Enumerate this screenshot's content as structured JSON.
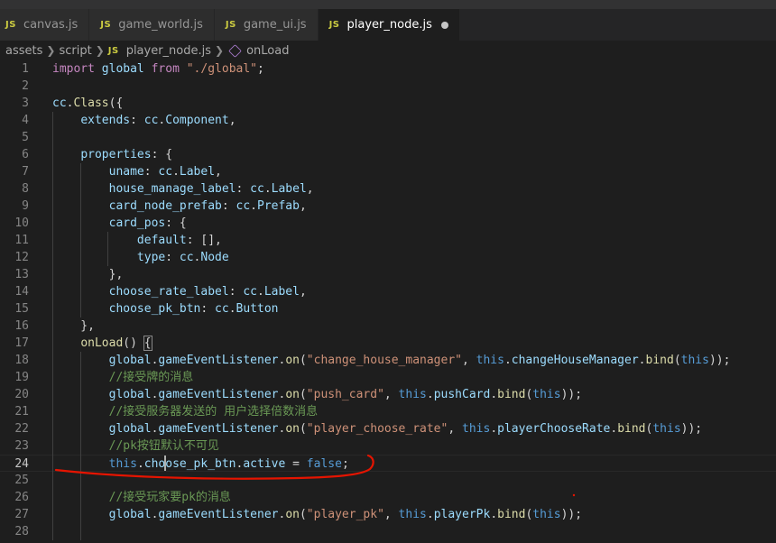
{
  "tabs": [
    {
      "label": "canvas.js",
      "active": false
    },
    {
      "label": "game_world.js",
      "active": false
    },
    {
      "label": "game_ui.js",
      "active": false
    },
    {
      "label": "player_node.js",
      "active": true,
      "dirty": true
    }
  ],
  "breadcrumb": {
    "items": [
      "assets",
      "script"
    ],
    "file": "player_node.js",
    "symbol": "onLoad"
  },
  "editor": {
    "current_line": 24,
    "lines": [
      {
        "n": "1",
        "tokens": [
          [
            "kw",
            "import"
          ],
          [
            "pun",
            " "
          ],
          [
            "var",
            "global"
          ],
          [
            "pun",
            " "
          ],
          [
            "kw",
            "from"
          ],
          [
            "pun",
            " "
          ],
          [
            "str",
            "\"./global\""
          ],
          [
            "pun",
            ";"
          ]
        ]
      },
      {
        "n": "2",
        "tokens": []
      },
      {
        "n": "3",
        "tokens": [
          [
            "var",
            "cc"
          ],
          [
            "pun",
            "."
          ],
          [
            "fn",
            "Class"
          ],
          [
            "pun",
            "({"
          ]
        ]
      },
      {
        "n": "4",
        "tokens": [
          [
            "pun",
            "    "
          ],
          [
            "var",
            "extends"
          ],
          [
            "pun",
            ": "
          ],
          [
            "var",
            "cc"
          ],
          [
            "pun",
            "."
          ],
          [
            "var",
            "Component"
          ],
          [
            "pun",
            ","
          ]
        ]
      },
      {
        "n": "5",
        "tokens": []
      },
      {
        "n": "6",
        "tokens": [
          [
            "pun",
            "    "
          ],
          [
            "var",
            "properties"
          ],
          [
            "pun",
            ": {"
          ]
        ]
      },
      {
        "n": "7",
        "tokens": [
          [
            "pun",
            "        "
          ],
          [
            "var",
            "uname"
          ],
          [
            "pun",
            ": "
          ],
          [
            "var",
            "cc"
          ],
          [
            "pun",
            "."
          ],
          [
            "var",
            "Label"
          ],
          [
            "pun",
            ","
          ]
        ]
      },
      {
        "n": "8",
        "tokens": [
          [
            "pun",
            "        "
          ],
          [
            "var",
            "house_manage_label"
          ],
          [
            "pun",
            ": "
          ],
          [
            "var",
            "cc"
          ],
          [
            "pun",
            "."
          ],
          [
            "var",
            "Label"
          ],
          [
            "pun",
            ","
          ]
        ]
      },
      {
        "n": "9",
        "tokens": [
          [
            "pun",
            "        "
          ],
          [
            "var",
            "card_node_prefab"
          ],
          [
            "pun",
            ": "
          ],
          [
            "var",
            "cc"
          ],
          [
            "pun",
            "."
          ],
          [
            "var",
            "Prefab"
          ],
          [
            "pun",
            ","
          ]
        ]
      },
      {
        "n": "10",
        "tokens": [
          [
            "pun",
            "        "
          ],
          [
            "var",
            "card_pos"
          ],
          [
            "pun",
            ": {"
          ]
        ]
      },
      {
        "n": "11",
        "tokens": [
          [
            "pun",
            "            "
          ],
          [
            "var",
            "default"
          ],
          [
            "pun",
            ": [],"
          ]
        ]
      },
      {
        "n": "12",
        "tokens": [
          [
            "pun",
            "            "
          ],
          [
            "var",
            "type"
          ],
          [
            "pun",
            ": "
          ],
          [
            "var",
            "cc"
          ],
          [
            "pun",
            "."
          ],
          [
            "var",
            "Node"
          ]
        ]
      },
      {
        "n": "13",
        "tokens": [
          [
            "pun",
            "        },"
          ]
        ]
      },
      {
        "n": "14",
        "tokens": [
          [
            "pun",
            "        "
          ],
          [
            "var",
            "choose_rate_label"
          ],
          [
            "pun",
            ": "
          ],
          [
            "var",
            "cc"
          ],
          [
            "pun",
            "."
          ],
          [
            "var",
            "Label"
          ],
          [
            "pun",
            ","
          ]
        ]
      },
      {
        "n": "15",
        "tokens": [
          [
            "pun",
            "        "
          ],
          [
            "var",
            "choose_pk_btn"
          ],
          [
            "pun",
            ": "
          ],
          [
            "var",
            "cc"
          ],
          [
            "pun",
            "."
          ],
          [
            "var",
            "Button"
          ]
        ]
      },
      {
        "n": "16",
        "tokens": [
          [
            "pun",
            "    },"
          ]
        ]
      },
      {
        "n": "17",
        "tokens": [
          [
            "pun",
            "    "
          ],
          [
            "fn",
            "onLoad"
          ],
          [
            "pun",
            "() "
          ],
          [
            "brk",
            "{"
          ]
        ]
      },
      {
        "n": "18",
        "tokens": [
          [
            "pun",
            "        "
          ],
          [
            "var",
            "global"
          ],
          [
            "pun",
            "."
          ],
          [
            "var",
            "gameEventListener"
          ],
          [
            "pun",
            "."
          ],
          [
            "fn",
            "on"
          ],
          [
            "pun",
            "("
          ],
          [
            "str",
            "\"change_house_manager\""
          ],
          [
            "pun",
            ", "
          ],
          [
            "this",
            "this"
          ],
          [
            "pun",
            "."
          ],
          [
            "var",
            "changeHouseManager"
          ],
          [
            "pun",
            "."
          ],
          [
            "fn",
            "bind"
          ],
          [
            "pun",
            "("
          ],
          [
            "this",
            "this"
          ],
          [
            "pun",
            "));"
          ]
        ]
      },
      {
        "n": "19",
        "tokens": [
          [
            "pun",
            "        "
          ],
          [
            "cmt",
            "//接受牌的消息"
          ]
        ]
      },
      {
        "n": "20",
        "tokens": [
          [
            "pun",
            "        "
          ],
          [
            "var",
            "global"
          ],
          [
            "pun",
            "."
          ],
          [
            "var",
            "gameEventListener"
          ],
          [
            "pun",
            "."
          ],
          [
            "fn",
            "on"
          ],
          [
            "pun",
            "("
          ],
          [
            "str",
            "\"push_card\""
          ],
          [
            "pun",
            ", "
          ],
          [
            "this",
            "this"
          ],
          [
            "pun",
            "."
          ],
          [
            "var",
            "pushCard"
          ],
          [
            "pun",
            "."
          ],
          [
            "fn",
            "bind"
          ],
          [
            "pun",
            "("
          ],
          [
            "this",
            "this"
          ],
          [
            "pun",
            "));"
          ]
        ]
      },
      {
        "n": "21",
        "tokens": [
          [
            "pun",
            "        "
          ],
          [
            "cmt",
            "//接受服务器发送的 用户选择倍数消息"
          ]
        ]
      },
      {
        "n": "22",
        "tokens": [
          [
            "pun",
            "        "
          ],
          [
            "var",
            "global"
          ],
          [
            "pun",
            "."
          ],
          [
            "var",
            "gameEventListener"
          ],
          [
            "pun",
            "."
          ],
          [
            "fn",
            "on"
          ],
          [
            "pun",
            "("
          ],
          [
            "str",
            "\"player_choose_rate\""
          ],
          [
            "pun",
            ", "
          ],
          [
            "this",
            "this"
          ],
          [
            "pun",
            "."
          ],
          [
            "var",
            "playerChooseRate"
          ],
          [
            "pun",
            "."
          ],
          [
            "fn",
            "bind"
          ],
          [
            "pun",
            "("
          ],
          [
            "this",
            "this"
          ],
          [
            "pun",
            "));"
          ]
        ]
      },
      {
        "n": "23",
        "tokens": [
          [
            "pun",
            "        "
          ],
          [
            "cmt",
            "//pk按钮默认不可见"
          ]
        ]
      },
      {
        "n": "24",
        "tokens": [
          [
            "pun",
            "        "
          ],
          [
            "this",
            "this"
          ],
          [
            "pun",
            "."
          ],
          [
            "var",
            "choose_pk_btn"
          ],
          [
            "pun",
            "."
          ],
          [
            "var",
            "active"
          ],
          [
            "pun",
            " = "
          ],
          [
            "this",
            "false"
          ],
          [
            "pun",
            ";"
          ]
        ]
      },
      {
        "n": "25",
        "tokens": []
      },
      {
        "n": "26",
        "tokens": [
          [
            "pun",
            "        "
          ],
          [
            "cmt",
            "//接受玩家要pk的消息"
          ]
        ]
      },
      {
        "n": "27",
        "tokens": [
          [
            "pun",
            "        "
          ],
          [
            "var",
            "global"
          ],
          [
            "pun",
            "."
          ],
          [
            "var",
            "gameEventListener"
          ],
          [
            "pun",
            "."
          ],
          [
            "fn",
            "on"
          ],
          [
            "pun",
            "("
          ],
          [
            "str",
            "\"player_pk\""
          ],
          [
            "pun",
            ", "
          ],
          [
            "this",
            "this"
          ],
          [
            "pun",
            "."
          ],
          [
            "var",
            "playerPk"
          ],
          [
            "pun",
            "."
          ],
          [
            "fn",
            "bind"
          ],
          [
            "pun",
            "("
          ],
          [
            "this",
            "this"
          ],
          [
            "pun",
            "));"
          ]
        ]
      },
      {
        "n": "28",
        "tokens": []
      }
    ]
  },
  "colors": {
    "background": "#1e1e1e",
    "keyword": "#c586c0",
    "variable": "#9cdcfe",
    "string": "#ce9178",
    "function": "#dcdcaa",
    "comment": "#6a9955",
    "this": "#569cd6",
    "annotation": "#e51400"
  }
}
